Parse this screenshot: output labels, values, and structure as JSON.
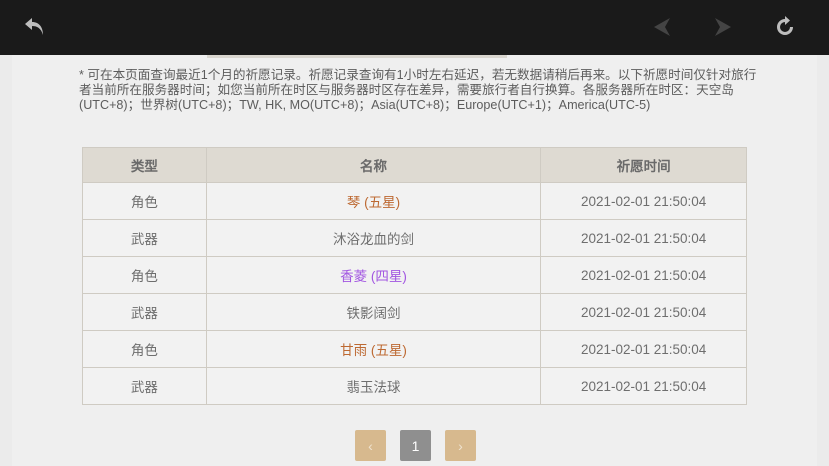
{
  "toolbar": {
    "back_icon": "undo-arrow-icon",
    "prev_icon": "nav-back-icon",
    "next_icon": "nav-forward-icon",
    "refresh_icon": "refresh-icon"
  },
  "notice": "* 可在本页面查询最近1个月的祈愿记录。祈愿记录查询有1小时左右延迟，若无数据请稍后再来。以下祈愿时间仅针对旅行者当前所在服务器时间；如您当前所在时区与服务器时区存在差异，需要旅行者自行换算。各服务器所在时区：天空岛(UTC+8)；世界树(UTC+8)；TW, HK, MO(UTC+8)；Asia(UTC+8)；Europe(UTC+1)；America(UTC-5)",
  "table": {
    "headers": [
      "类型",
      "名称",
      "祈愿时间"
    ],
    "rows": [
      {
        "type": "角色",
        "name": "琴 (五星)",
        "time": "2021-02-01 21:50:04"
      },
      {
        "type": "武器",
        "name": "沐浴龙血的剑",
        "time": "2021-02-01 21:50:04"
      },
      {
        "type": "角色",
        "name": "香菱 (四星)",
        "time": "2021-02-01 21:50:04"
      },
      {
        "type": "武器",
        "name": "铁影阔剑",
        "time": "2021-02-01 21:50:04"
      },
      {
        "type": "角色",
        "name": "甘雨 (五星)",
        "time": "2021-02-01 21:50:04"
      },
      {
        "type": "武器",
        "name": "翡玉法球",
        "time": "2021-02-01 21:50:04"
      }
    ]
  },
  "colors": {
    "five_star": "#bd6932",
    "four_star": "#a256e1",
    "three_star": "#6e6e6e"
  },
  "pagination": {
    "prev": "‹",
    "current": "1",
    "next": "›"
  }
}
